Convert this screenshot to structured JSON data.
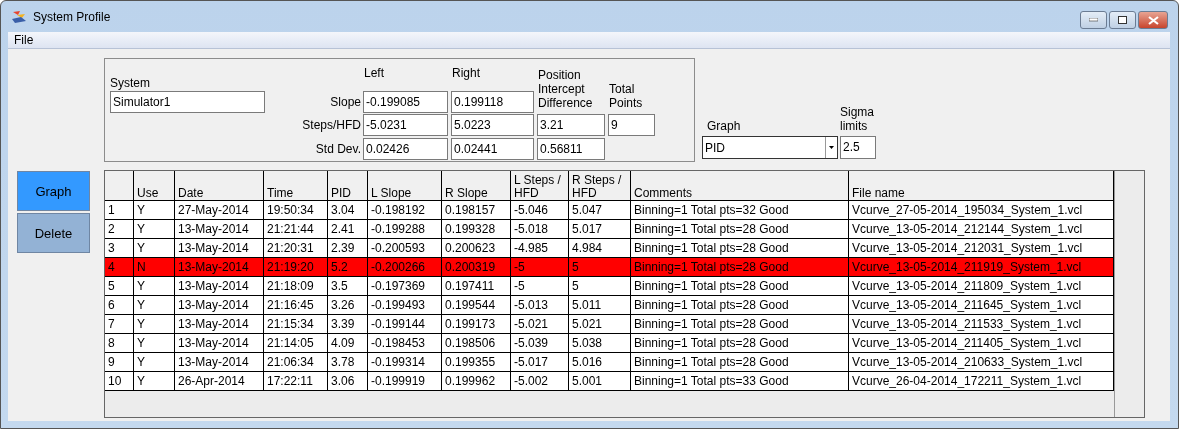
{
  "window": {
    "title": "System Profile"
  },
  "menu": [
    "File"
  ],
  "system": {
    "label": "System",
    "value": "Simulator1"
  },
  "stats": {
    "columns": [
      "Left",
      "Right",
      "Position Intercept Difference",
      "Total Points"
    ],
    "rows": [
      {
        "label": "Slope",
        "values": [
          "-0.199085",
          "0.199118"
        ]
      },
      {
        "label": "Steps/HFD",
        "values": [
          "-5.0231",
          "5.0223",
          "3.21",
          "9"
        ]
      },
      {
        "label": "Std Dev.",
        "values": [
          "0.02426",
          "0.02441",
          "0.56811"
        ]
      }
    ]
  },
  "graph": {
    "label": "Graph",
    "value": "PID"
  },
  "sigma": {
    "label": "Sigma limits",
    "value": "2.5"
  },
  "buttons": [
    {
      "label": "Graph",
      "selected": true
    },
    {
      "label": "Delete",
      "selected": false
    }
  ],
  "table": {
    "columns": [
      "",
      "Use",
      "Date",
      "Time",
      "PID",
      "L Slope",
      "R Slope",
      "L Steps / HFD",
      "R Steps / HFD",
      "Comments",
      "File name"
    ],
    "rows": [
      {
        "flagged": false,
        "cells": [
          "1",
          "Y",
          "27-May-2014",
          "19:50:34",
          "3.04",
          "-0.198192",
          "0.198157",
          "-5.046",
          "5.047",
          "Binning=1 Total pts=32 Good",
          "Vcurve_27-05-2014_195034_System_1.vcl"
        ]
      },
      {
        "flagged": false,
        "cells": [
          "2",
          "Y",
          "13-May-2014",
          "21:21:44",
          "2.41",
          "-0.199288",
          "0.199328",
          "-5.018",
          "5.017",
          "Binning=1 Total pts=28 Good",
          "Vcurve_13-05-2014_212144_System_1.vcl"
        ]
      },
      {
        "flagged": false,
        "cells": [
          "3",
          "Y",
          "13-May-2014",
          "21:20:31",
          "2.39",
          "-0.200593",
          "0.200623",
          "-4.985",
          "4.984",
          "Binning=1 Total pts=28 Good",
          "Vcurve_13-05-2014_212031_System_1.vcl"
        ]
      },
      {
        "flagged": true,
        "cells": [
          "4",
          "N",
          "13-May-2014",
          "21:19:20",
          "5.2",
          "-0.200266",
          "0.200319",
          "-5",
          "5",
          "Binning=1 Total pts=28 Good",
          "Vcurve_13-05-2014_211919_System_1.vcl"
        ]
      },
      {
        "flagged": false,
        "cells": [
          "5",
          "Y",
          "13-May-2014",
          "21:18:09",
          "3.5",
          "-0.197369",
          "0.197411",
          "-5",
          "5",
          "Binning=1 Total pts=28 Good",
          "Vcurve_13-05-2014_211809_System_1.vcl"
        ]
      },
      {
        "flagged": false,
        "cells": [
          "6",
          "Y",
          "13-May-2014",
          "21:16:45",
          "3.26",
          "-0.199493",
          "0.199544",
          "-5.013",
          "5.011",
          "Binning=1 Total pts=28 Good",
          "Vcurve_13-05-2014_211645_System_1.vcl"
        ]
      },
      {
        "flagged": false,
        "cells": [
          "7",
          "Y",
          "13-May-2014",
          "21:15:34",
          "3.39",
          "-0.199144",
          "0.199173",
          "-5.021",
          "5.021",
          "Binning=1 Total pts=28 Good",
          "Vcurve_13-05-2014_211533_System_1.vcl"
        ]
      },
      {
        "flagged": false,
        "cells": [
          "8",
          "Y",
          "13-May-2014",
          "21:14:05",
          "4.09",
          "-0.198453",
          "0.198506",
          "-5.039",
          "5.038",
          "Binning=1 Total pts=28 Good",
          "Vcurve_13-05-2014_211405_System_1.vcl"
        ]
      },
      {
        "flagged": false,
        "cells": [
          "9",
          "Y",
          "13-May-2014",
          "21:06:34",
          "3.78",
          "-0.199314",
          "0.199355",
          "-5.017",
          "5.016",
          "Binning=1 Total pts=28 Good",
          "Vcurve_13-05-2014_210633_System_1.vcl"
        ]
      },
      {
        "flagged": false,
        "cells": [
          "10",
          "Y",
          "26-Apr-2014",
          "17:22:11",
          "3.06",
          "-0.199919",
          "0.199962",
          "-5.002",
          "5.001",
          "Binning=1 Total pts=33 Good",
          "Vcurve_26-04-2014_172211_System_1.vcl"
        ]
      }
    ]
  }
}
